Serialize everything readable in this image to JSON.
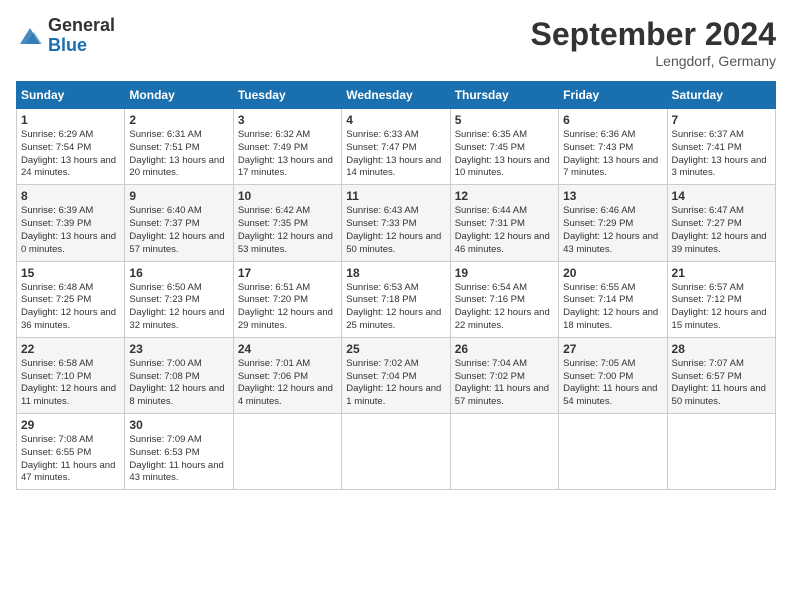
{
  "header": {
    "logo_general": "General",
    "logo_blue": "Blue",
    "month_title": "September 2024",
    "location": "Lengdorf, Germany"
  },
  "days_of_week": [
    "Sunday",
    "Monday",
    "Tuesday",
    "Wednesday",
    "Thursday",
    "Friday",
    "Saturday"
  ],
  "weeks": [
    [
      {
        "day": 1,
        "sunrise": "6:29 AM",
        "sunset": "7:54 PM",
        "daylight": "13 hours and 24 minutes."
      },
      {
        "day": 2,
        "sunrise": "6:31 AM",
        "sunset": "7:51 PM",
        "daylight": "13 hours and 20 minutes."
      },
      {
        "day": 3,
        "sunrise": "6:32 AM",
        "sunset": "7:49 PM",
        "daylight": "13 hours and 17 minutes."
      },
      {
        "day": 4,
        "sunrise": "6:33 AM",
        "sunset": "7:47 PM",
        "daylight": "13 hours and 14 minutes."
      },
      {
        "day": 5,
        "sunrise": "6:35 AM",
        "sunset": "7:45 PM",
        "daylight": "13 hours and 10 minutes."
      },
      {
        "day": 6,
        "sunrise": "6:36 AM",
        "sunset": "7:43 PM",
        "daylight": "13 hours and 7 minutes."
      },
      {
        "day": 7,
        "sunrise": "6:37 AM",
        "sunset": "7:41 PM",
        "daylight": "13 hours and 3 minutes."
      }
    ],
    [
      {
        "day": 8,
        "sunrise": "6:39 AM",
        "sunset": "7:39 PM",
        "daylight": "13 hours and 0 minutes."
      },
      {
        "day": 9,
        "sunrise": "6:40 AM",
        "sunset": "7:37 PM",
        "daylight": "12 hours and 57 minutes."
      },
      {
        "day": 10,
        "sunrise": "6:42 AM",
        "sunset": "7:35 PM",
        "daylight": "12 hours and 53 minutes."
      },
      {
        "day": 11,
        "sunrise": "6:43 AM",
        "sunset": "7:33 PM",
        "daylight": "12 hours and 50 minutes."
      },
      {
        "day": 12,
        "sunrise": "6:44 AM",
        "sunset": "7:31 PM",
        "daylight": "12 hours and 46 minutes."
      },
      {
        "day": 13,
        "sunrise": "6:46 AM",
        "sunset": "7:29 PM",
        "daylight": "12 hours and 43 minutes."
      },
      {
        "day": 14,
        "sunrise": "6:47 AM",
        "sunset": "7:27 PM",
        "daylight": "12 hours and 39 minutes."
      }
    ],
    [
      {
        "day": 15,
        "sunrise": "6:48 AM",
        "sunset": "7:25 PM",
        "daylight": "12 hours and 36 minutes."
      },
      {
        "day": 16,
        "sunrise": "6:50 AM",
        "sunset": "7:23 PM",
        "daylight": "12 hours and 32 minutes."
      },
      {
        "day": 17,
        "sunrise": "6:51 AM",
        "sunset": "7:20 PM",
        "daylight": "12 hours and 29 minutes."
      },
      {
        "day": 18,
        "sunrise": "6:53 AM",
        "sunset": "7:18 PM",
        "daylight": "12 hours and 25 minutes."
      },
      {
        "day": 19,
        "sunrise": "6:54 AM",
        "sunset": "7:16 PM",
        "daylight": "12 hours and 22 minutes."
      },
      {
        "day": 20,
        "sunrise": "6:55 AM",
        "sunset": "7:14 PM",
        "daylight": "12 hours and 18 minutes."
      },
      {
        "day": 21,
        "sunrise": "6:57 AM",
        "sunset": "7:12 PM",
        "daylight": "12 hours and 15 minutes."
      }
    ],
    [
      {
        "day": 22,
        "sunrise": "6:58 AM",
        "sunset": "7:10 PM",
        "daylight": "12 hours and 11 minutes."
      },
      {
        "day": 23,
        "sunrise": "7:00 AM",
        "sunset": "7:08 PM",
        "daylight": "12 hours and 8 minutes."
      },
      {
        "day": 24,
        "sunrise": "7:01 AM",
        "sunset": "7:06 PM",
        "daylight": "12 hours and 4 minutes."
      },
      {
        "day": 25,
        "sunrise": "7:02 AM",
        "sunset": "7:04 PM",
        "daylight": "12 hours and 1 minute."
      },
      {
        "day": 26,
        "sunrise": "7:04 AM",
        "sunset": "7:02 PM",
        "daylight": "11 hours and 57 minutes."
      },
      {
        "day": 27,
        "sunrise": "7:05 AM",
        "sunset": "7:00 PM",
        "daylight": "11 hours and 54 minutes."
      },
      {
        "day": 28,
        "sunrise": "7:07 AM",
        "sunset": "6:57 PM",
        "daylight": "11 hours and 50 minutes."
      }
    ],
    [
      {
        "day": 29,
        "sunrise": "7:08 AM",
        "sunset": "6:55 PM",
        "daylight": "11 hours and 47 minutes."
      },
      {
        "day": 30,
        "sunrise": "7:09 AM",
        "sunset": "6:53 PM",
        "daylight": "11 hours and 43 minutes."
      },
      null,
      null,
      null,
      null,
      null
    ]
  ]
}
